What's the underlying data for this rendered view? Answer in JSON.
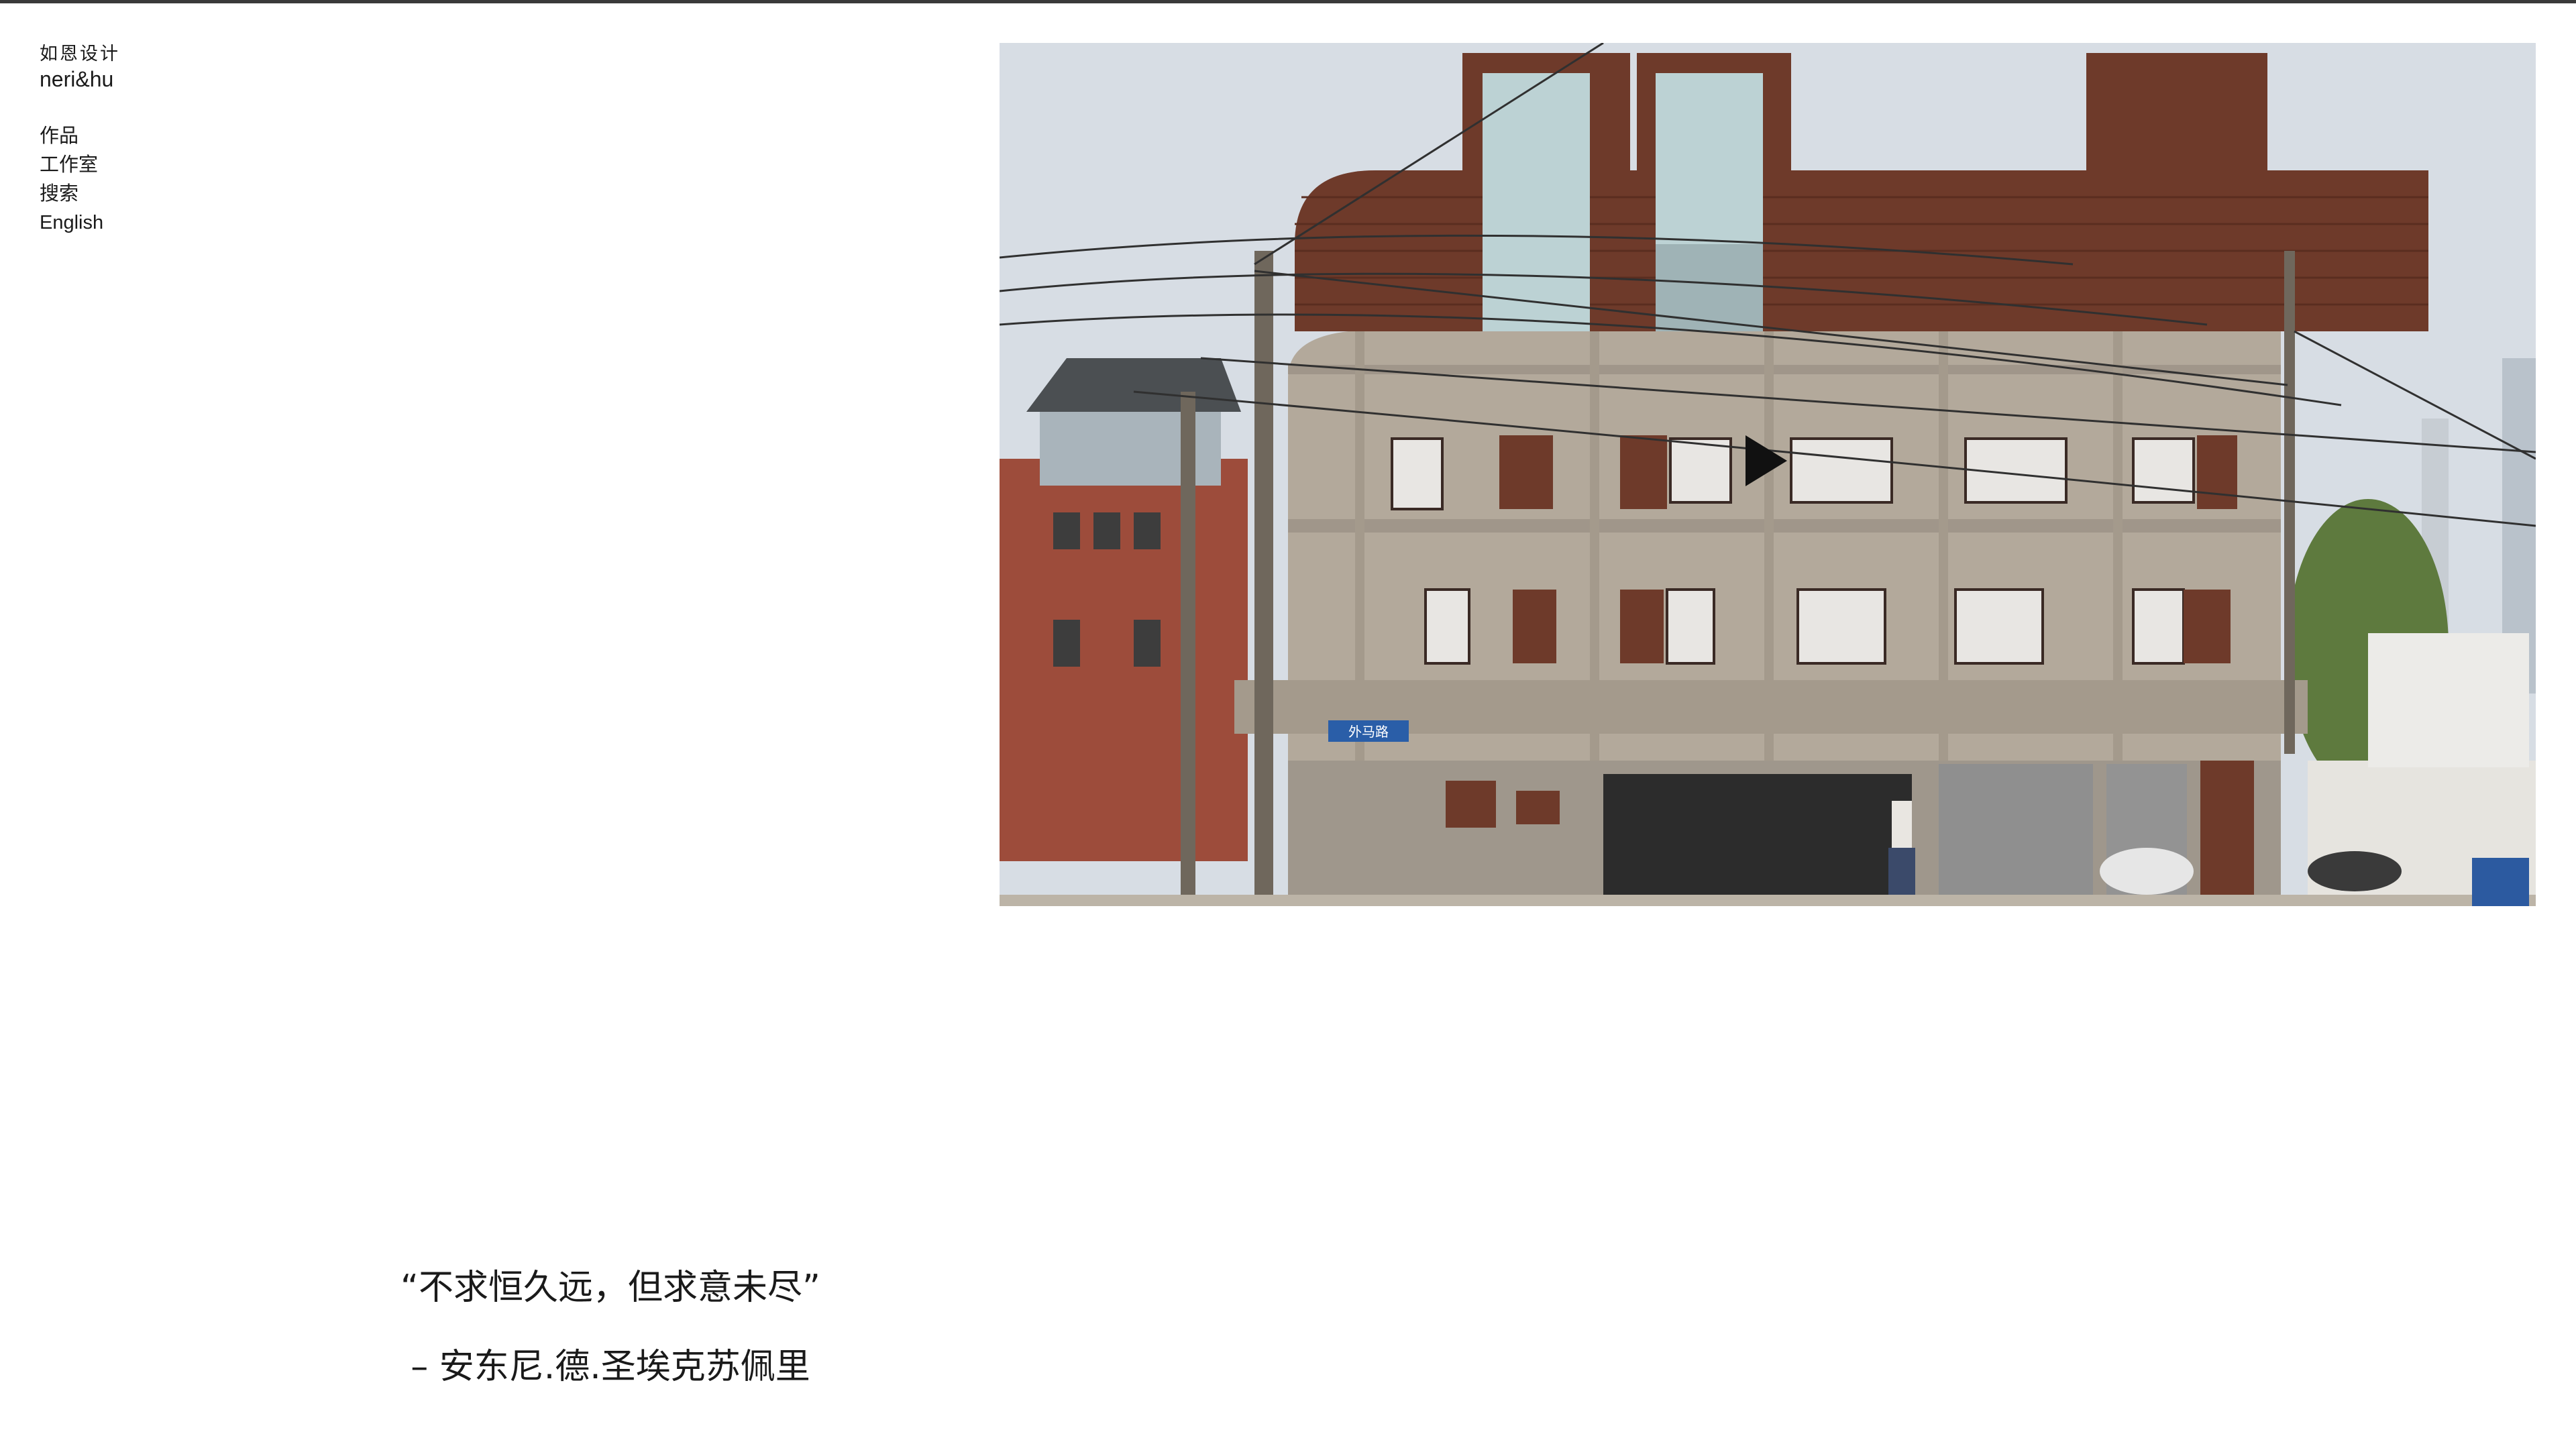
{
  "brand": {
    "name_cn": "如恩设计",
    "name_en": "neri&hu"
  },
  "nav": {
    "items": [
      {
        "label": "作品"
      },
      {
        "label": "工作室"
      },
      {
        "label": "搜索"
      },
      {
        "label": "English"
      }
    ]
  },
  "hero": {
    "media": "video",
    "play_icon": "play-icon",
    "street_sign": "外马路"
  },
  "quote": {
    "text": "“不求恒久远，但求意未尽”",
    "author": "– 安东尼.德.圣埃克苏佩里"
  },
  "colors": {
    "text": "#1a1a1a",
    "top_border": "#3a3a3a",
    "background": "#ffffff"
  }
}
